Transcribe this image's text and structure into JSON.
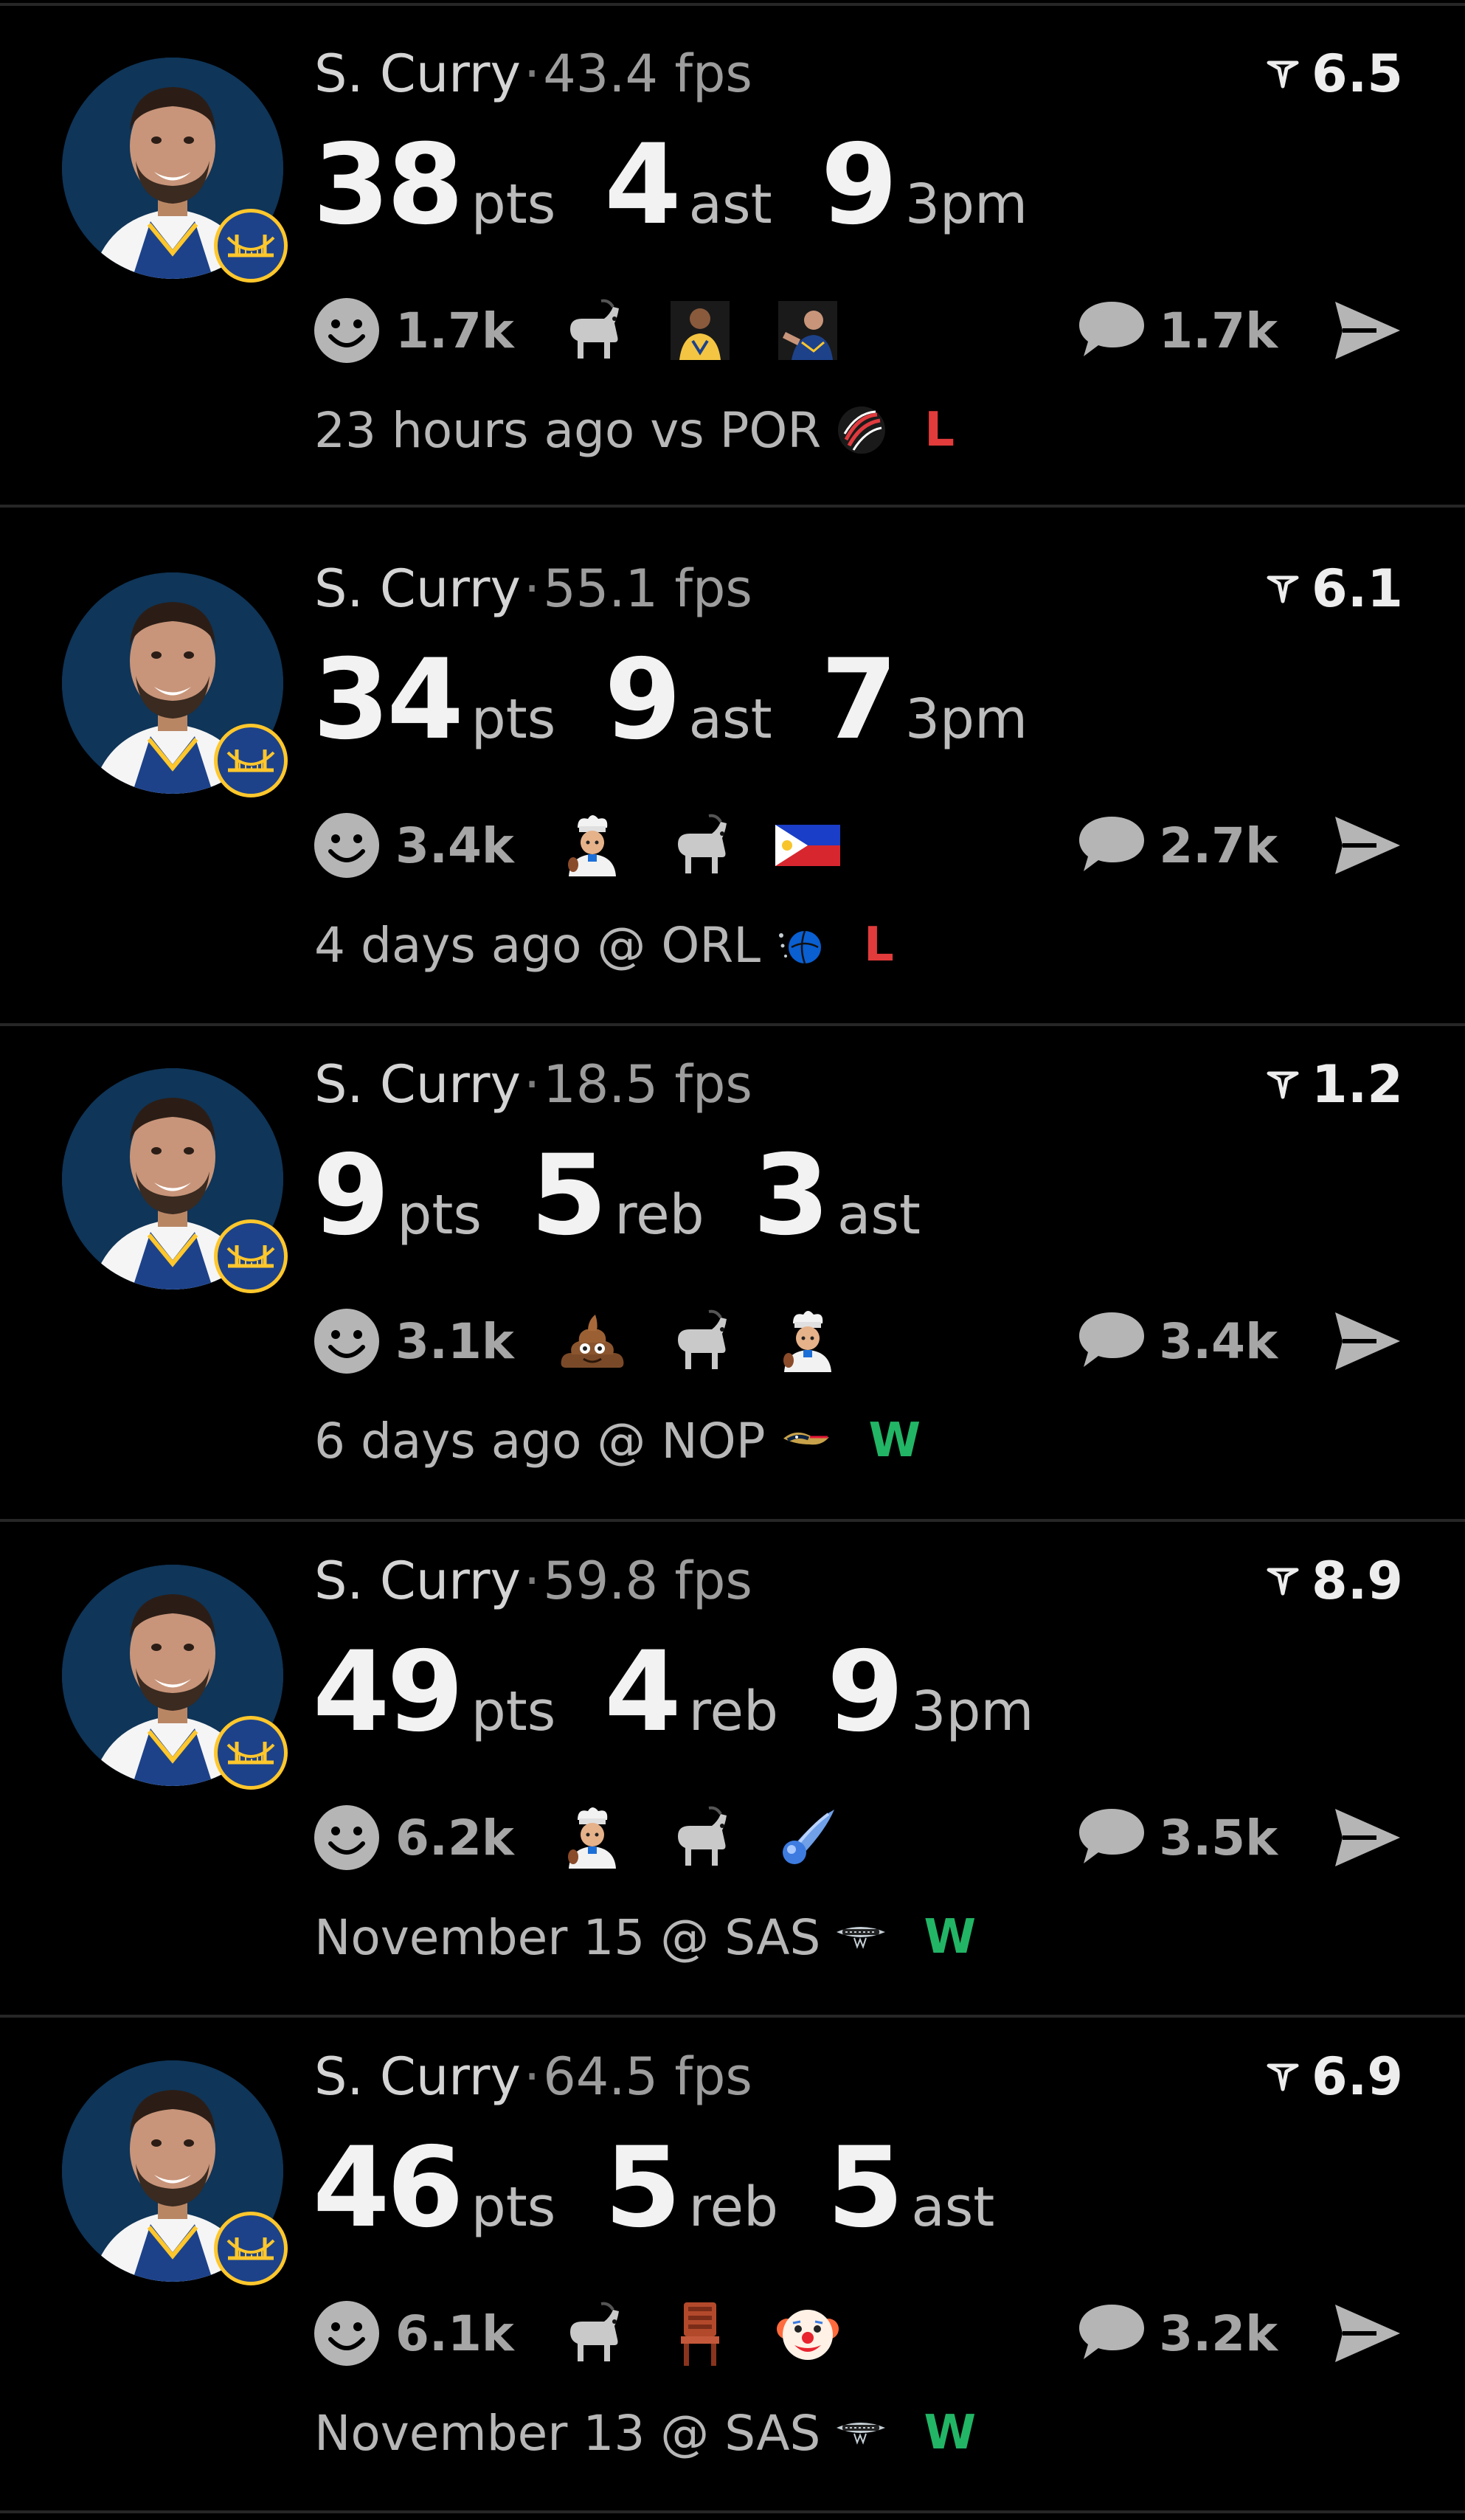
{
  "colors": {
    "background": "#000000",
    "loss": "#e23b3b",
    "win": "#22b566",
    "muted": "#a6a6a6"
  },
  "posts": [
    {
      "player": "S. Curry",
      "separator": "·",
      "fps": "43.4 fps",
      "score": "6.5",
      "stats": [
        {
          "value": "38",
          "unit": "pts"
        },
        {
          "value": "4",
          "unit": "ast"
        },
        {
          "value": "9",
          "unit": "3pm"
        }
      ],
      "reaction_count": "1.7k",
      "emojis": [
        "goat-emoji",
        "player-photo-emoji",
        "player-celebrate-emoji"
      ],
      "comment_count": "1.7k",
      "meta": "23 hours ago vs POR",
      "opponent_logo": "trail-blazers-logo",
      "result": "L"
    },
    {
      "player": "S. Curry",
      "separator": "·",
      "fps": "55.1 fps",
      "score": "6.1",
      "stats": [
        {
          "value": "34",
          "unit": "pts"
        },
        {
          "value": "9",
          "unit": "ast"
        },
        {
          "value": "7",
          "unit": "3pm"
        }
      ],
      "reaction_count": "3.4k",
      "emojis": [
        "chef-emoji",
        "goat-emoji",
        "philippines-flag-emoji"
      ],
      "comment_count": "2.7k",
      "meta": "4 days ago @ ORL",
      "opponent_logo": "magic-logo",
      "result": "L"
    },
    {
      "player": "S. Curry",
      "separator": "·",
      "fps": "18.5 fps",
      "score": "1.2",
      "stats": [
        {
          "value": "9",
          "unit": "pts"
        },
        {
          "value": "5",
          "unit": "reb"
        },
        {
          "value": "3",
          "unit": "ast"
        }
      ],
      "reaction_count": "3.1k",
      "emojis": [
        "poop-emoji",
        "goat-emoji",
        "chef-emoji"
      ],
      "comment_count": "3.4k",
      "meta": "6 days ago @ NOP",
      "opponent_logo": "pelicans-logo",
      "result": "W"
    },
    {
      "player": "S. Curry",
      "separator": "·",
      "fps": "59.8 fps",
      "score": "8.9",
      "stats": [
        {
          "value": "49",
          "unit": "pts"
        },
        {
          "value": "4",
          "unit": "reb"
        },
        {
          "value": "9",
          "unit": "3pm"
        }
      ],
      "reaction_count": "6.2k",
      "emojis": [
        "chef-emoji",
        "goat-emoji",
        "comet-emoji"
      ],
      "comment_count": "3.5k",
      "meta": "November 15 @ SAS",
      "opponent_logo": "spurs-logo",
      "result": "W"
    },
    {
      "player": "S. Curry",
      "separator": "·",
      "fps": "64.5 fps",
      "score": "6.9",
      "stats": [
        {
          "value": "46",
          "unit": "pts"
        },
        {
          "value": "5",
          "unit": "reb"
        },
        {
          "value": "5",
          "unit": "ast"
        }
      ],
      "reaction_count": "6.1k",
      "emojis": [
        "goat-emoji",
        "chair-emoji",
        "clown-emoji"
      ],
      "comment_count": "3.2k",
      "meta": "November 13 @ SAS",
      "opponent_logo": "spurs-logo",
      "result": "W"
    }
  ]
}
